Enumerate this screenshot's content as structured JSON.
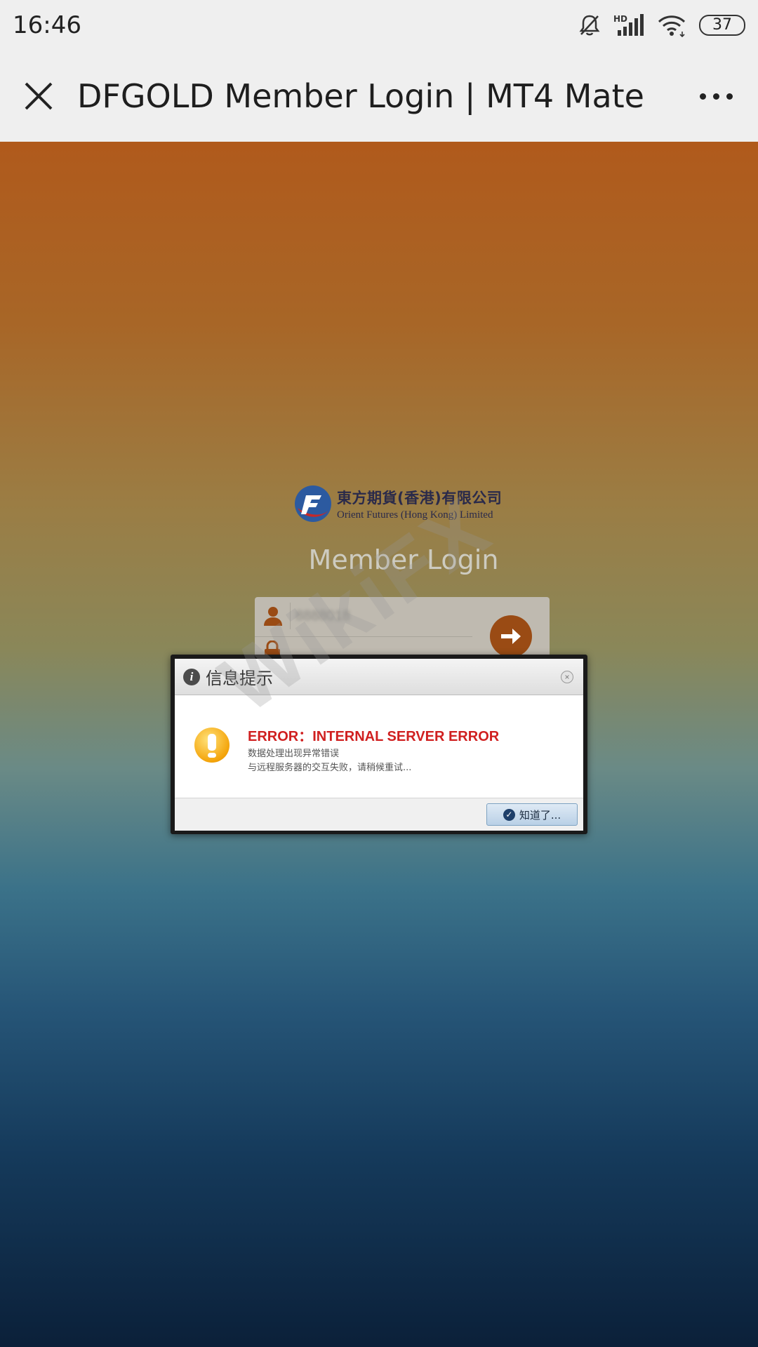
{
  "status_bar": {
    "time": "16:46",
    "icons": [
      "bell-muted-icon",
      "hd-signal-icon",
      "wifi-icon"
    ],
    "battery": "37"
  },
  "app_bar": {
    "title": "DFGOLD Member Login | MT4 Mate",
    "close_icon": "close-icon",
    "more_icon": "more-icon"
  },
  "brand": {
    "name_cn": "東方期貨(香港)有限公司",
    "name_en": "Orient Futures (Hong Kong) Limited"
  },
  "login": {
    "title": "Member Login",
    "user_value": "8888018"
  },
  "dialog": {
    "title": "信息提示",
    "error_title": "ERROR：INTERNAL SERVER ERROR",
    "line1": "数据处理出现异常错误",
    "line2": "与远程服务器的交互失败，请稍候重试...",
    "ok_label": "知道了..."
  },
  "watermark": "WikiFX",
  "colors": {
    "error_red": "#d02020",
    "button_brown": "#9a4b14",
    "accent_blue": "#1e3f6a"
  }
}
